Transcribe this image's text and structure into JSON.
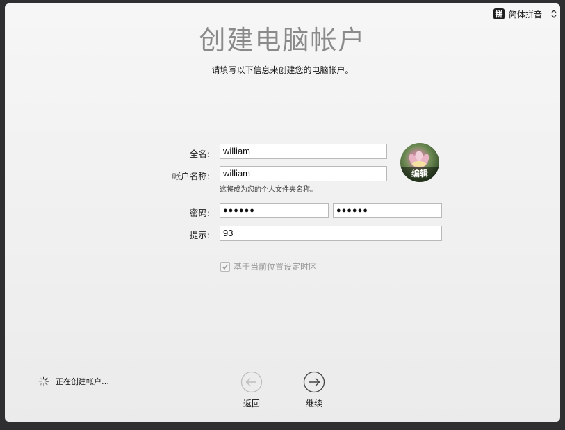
{
  "ime": {
    "badge": "拼",
    "label": "简体拼音"
  },
  "title": "创建电脑帐户",
  "subtitle": "请填写以下信息来创建您的电脑帐户。",
  "form": {
    "fullname_label": "全名:",
    "fullname_value": "william",
    "account_label": "帐户名称:",
    "account_value": "william",
    "account_hint": "这将成为您的个人文件夹名称。",
    "password_label": "密码:",
    "password_value": "●●●●●●",
    "verify_value": "●●●●●●",
    "hint_label": "提示:",
    "hint_value": "93"
  },
  "avatar": {
    "edit_label": "编辑"
  },
  "timezone_checkbox": {
    "label": "基于当前位置设定时区",
    "checked": true
  },
  "status": {
    "text": "正在创建帐户…"
  },
  "nav": {
    "back_label": "返回",
    "continue_label": "继续"
  }
}
